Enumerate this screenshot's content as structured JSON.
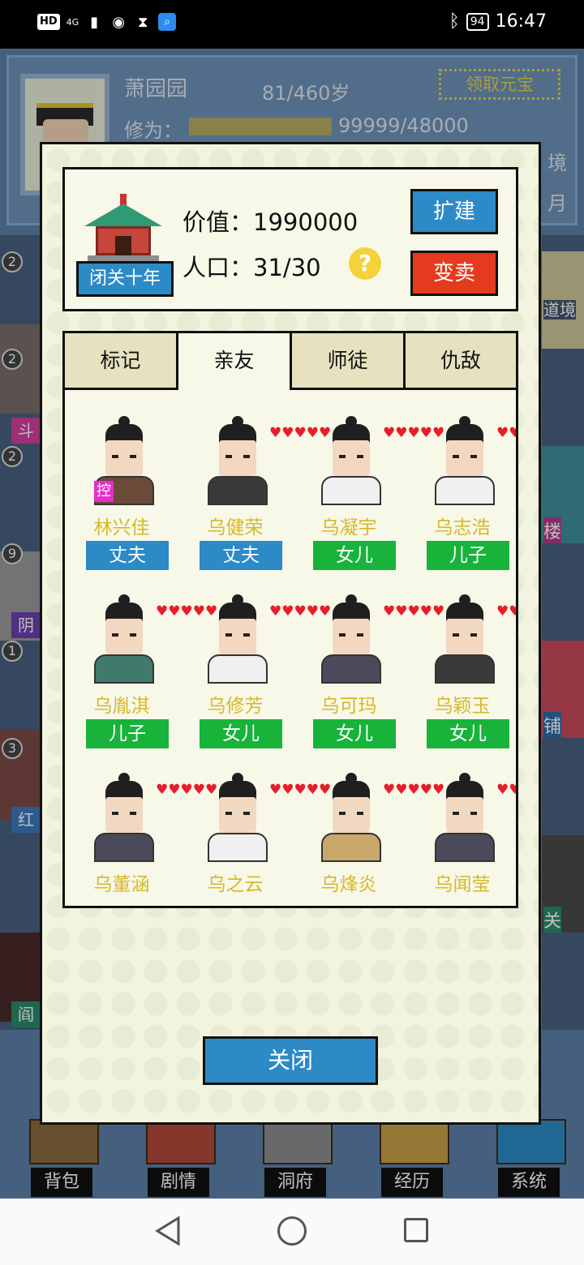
{
  "status_bar": {
    "left_chips": [
      "HD",
      "4G"
    ],
    "battery": "94",
    "time": "16:47"
  },
  "profile": {
    "name": "萧园园",
    "age": "81/460岁",
    "yuanbao_button": "领取元宝",
    "xiuwei_label": "修为：",
    "xiuwei_value": "99999/48000",
    "side_text_1": "境",
    "side_text_2": "月"
  },
  "left_column": {
    "badges": [
      "2",
      "2",
      "2",
      "9",
      "1",
      "3"
    ],
    "tags": [
      "斗",
      "阴",
      "红",
      "阎"
    ]
  },
  "right_column": {
    "texts": [
      "楼",
      "铺",
      "关"
    ],
    "dao_text": "道境"
  },
  "bottom_nav": [
    "背包",
    "剧情",
    "洞府",
    "经历",
    "系统"
  ],
  "modal": {
    "biguan_button": "闭关十年",
    "value_label": "价值：",
    "value": "1990000",
    "population_label": "人口：",
    "population": "31/30",
    "help_icon": "?",
    "expand_button": "扩建",
    "sell_button": "变卖",
    "tabs": [
      "标记",
      "亲友",
      "师徒",
      "仇敌"
    ],
    "active_tab": "亲友",
    "people": [
      {
        "name": "林兴佳",
        "relation": "丈夫",
        "color": "#2c8ac6",
        "hearts": "",
        "badge": "控"
      },
      {
        "name": "乌健荣",
        "relation": "丈夫",
        "color": "#2c8ac6",
        "hearts": "♥♥♥♥♥"
      },
      {
        "name": "乌凝宇",
        "relation": "女儿",
        "color": "#17b33b",
        "hearts": "♥♥♥♥♥"
      },
      {
        "name": "乌志浩",
        "relation": "儿子",
        "color": "#17b33b",
        "hearts": "♥♥♥♥♥"
      },
      {
        "name": "乌胤淇",
        "relation": "儿子",
        "color": "#17b33b",
        "hearts": "♥♥♥♥♥"
      },
      {
        "name": "乌修芳",
        "relation": "女儿",
        "color": "#17b33b",
        "hearts": "♥♥♥♥♥"
      },
      {
        "name": "乌可玛",
        "relation": "女儿",
        "color": "#17b33b",
        "hearts": "♥♥♥♥♥"
      },
      {
        "name": "乌颖玉",
        "relation": "女儿",
        "color": "#17b33b",
        "hearts": "♥♥♥♥♥"
      },
      {
        "name": "乌董涵",
        "relation": "",
        "color": "#17b33b",
        "hearts": "♥♥♥♥♥"
      },
      {
        "name": "乌之云",
        "relation": "",
        "color": "#17b33b",
        "hearts": "♥♥♥♥♥"
      },
      {
        "name": "乌烽炎",
        "relation": "",
        "color": "#17b33b",
        "hearts": "♥♥♥♥♥"
      },
      {
        "name": "乌闻莹",
        "relation": "",
        "color": "#17b33b",
        "hearts": "♥♥♥♥♥"
      }
    ],
    "close_button": "关闭"
  }
}
